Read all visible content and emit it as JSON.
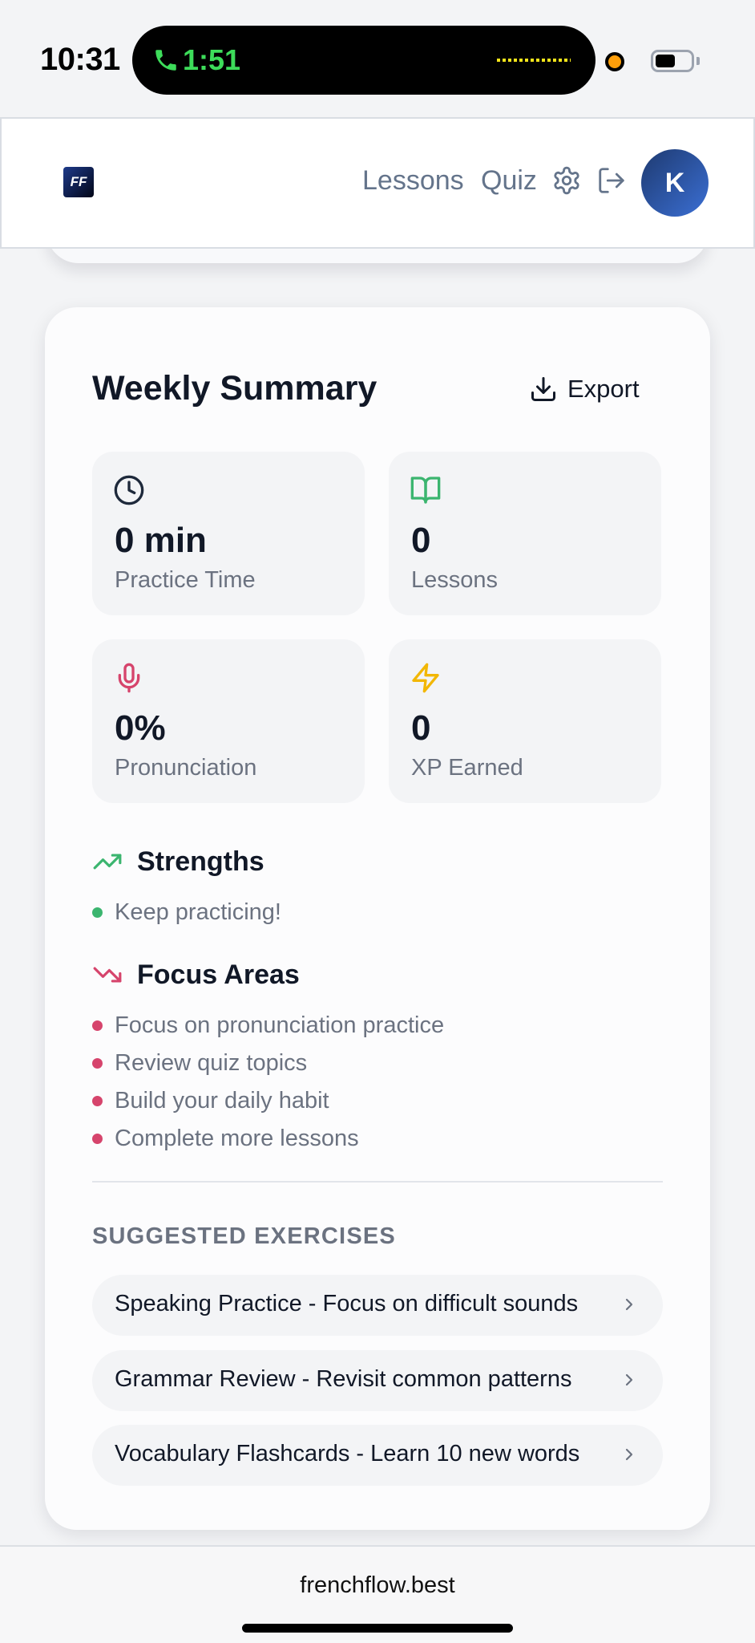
{
  "status_bar": {
    "time": "10:31",
    "call_timer": "1:51"
  },
  "header": {
    "logo_text": "FF",
    "nav": {
      "lessons": "Lessons",
      "quiz": "Quiz"
    },
    "avatar_initial": "K"
  },
  "summary": {
    "title": "Weekly Summary",
    "export_label": "Export",
    "stats": [
      {
        "icon": "clock-icon",
        "value": "0 min",
        "label": "Practice Time",
        "color": "#1e293b"
      },
      {
        "icon": "book-open-icon",
        "value": "0",
        "label": "Lessons",
        "color": "#3bb56f"
      },
      {
        "icon": "mic-icon",
        "value": "0%",
        "label": "Pronunciation",
        "color": "#d6446c"
      },
      {
        "icon": "zap-icon",
        "value": "0",
        "label": "XP Earned",
        "color": "#f2b705"
      }
    ],
    "strengths": {
      "title": "Strengths",
      "items": [
        "Keep practicing!"
      ]
    },
    "focus_areas": {
      "title": "Focus Areas",
      "items": [
        "Focus on pronunciation practice",
        "Review quiz topics",
        "Build your daily habit",
        "Complete more lessons"
      ]
    },
    "suggested": {
      "title": "SUGGESTED EXERCISES",
      "items": [
        "Speaking Practice - Focus on difficult sounds",
        "Grammar Review - Revisit common patterns",
        "Vocabulary Flashcards - Learn 10 new words"
      ]
    }
  },
  "browser": {
    "url": "frenchflow.best"
  }
}
